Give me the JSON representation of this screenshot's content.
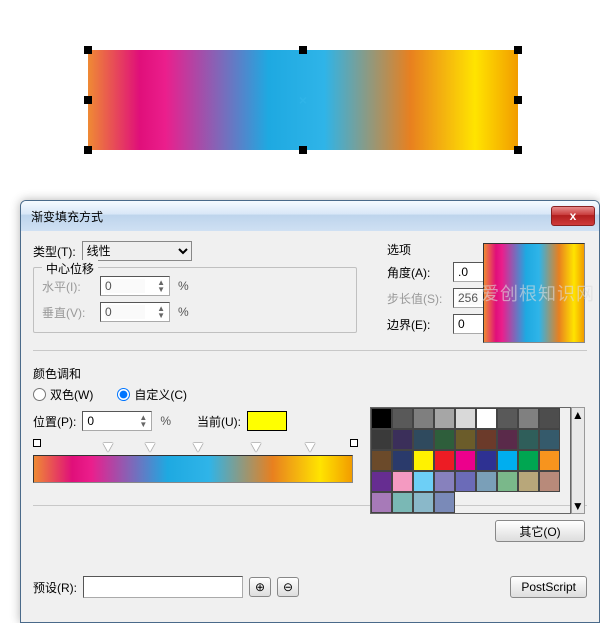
{
  "watermark": "爱创根知识网",
  "dialog": {
    "title": "渐变填充方式",
    "close": "x"
  },
  "type": {
    "label": "类型(T):",
    "value": "线性"
  },
  "center_offset": {
    "title": "中心位移",
    "horizontal_label": "水平(I):",
    "horizontal_value": "0",
    "vertical_label": "垂直(V):",
    "vertical_value": "0",
    "unit": "%"
  },
  "options": {
    "title": "选项",
    "angle_label": "角度(A):",
    "angle_value": ".0",
    "step_label": "步长值(S):",
    "step_value": "256",
    "edge_label": "边界(E):",
    "edge_value": "0",
    "edge_unit": "%"
  },
  "blend": {
    "title": "颜色调和",
    "two_color": "双色(W)",
    "custom": "自定义(C)",
    "position_label": "位置(P):",
    "position_value": "0",
    "position_unit": "%",
    "current_label": "当前(U):"
  },
  "other_button": "其它(O)",
  "preset": {
    "label": "预设(R):"
  },
  "postscript_label": "PostScript",
  "icons": {
    "plus": "⊕",
    "minus": "⊖",
    "lock": "🔒"
  },
  "palette_colors": [
    "#000000",
    "#595959",
    "#7f7f7f",
    "#a6a6a6",
    "#d9d9d9",
    "#ffffff",
    "#595959",
    "#808080",
    "#4d4d4d",
    "#3a3a3a",
    "#3b2f5a",
    "#2f4a5e",
    "#2e5e3b",
    "#6b5c2a",
    "#6b3a2a",
    "#5a2a4a",
    "#2f5e5a",
    "#355a6b",
    "#6b4a2a",
    "#2a3a6b",
    "#fff200",
    "#ed1c24",
    "#ec008c",
    "#2e3192",
    "#00aeef",
    "#00a651",
    "#f7941e",
    "#662d91",
    "#f49ac1",
    "#6dcff6",
    "#8781bd",
    "#6b6bb8",
    "#7a9fb8",
    "#7ab88a",
    "#b8a77a",
    "#b88a7a",
    "#a77ab8",
    "#7ab8b5",
    "#8ab8c9",
    "#7a8ab8"
  ]
}
